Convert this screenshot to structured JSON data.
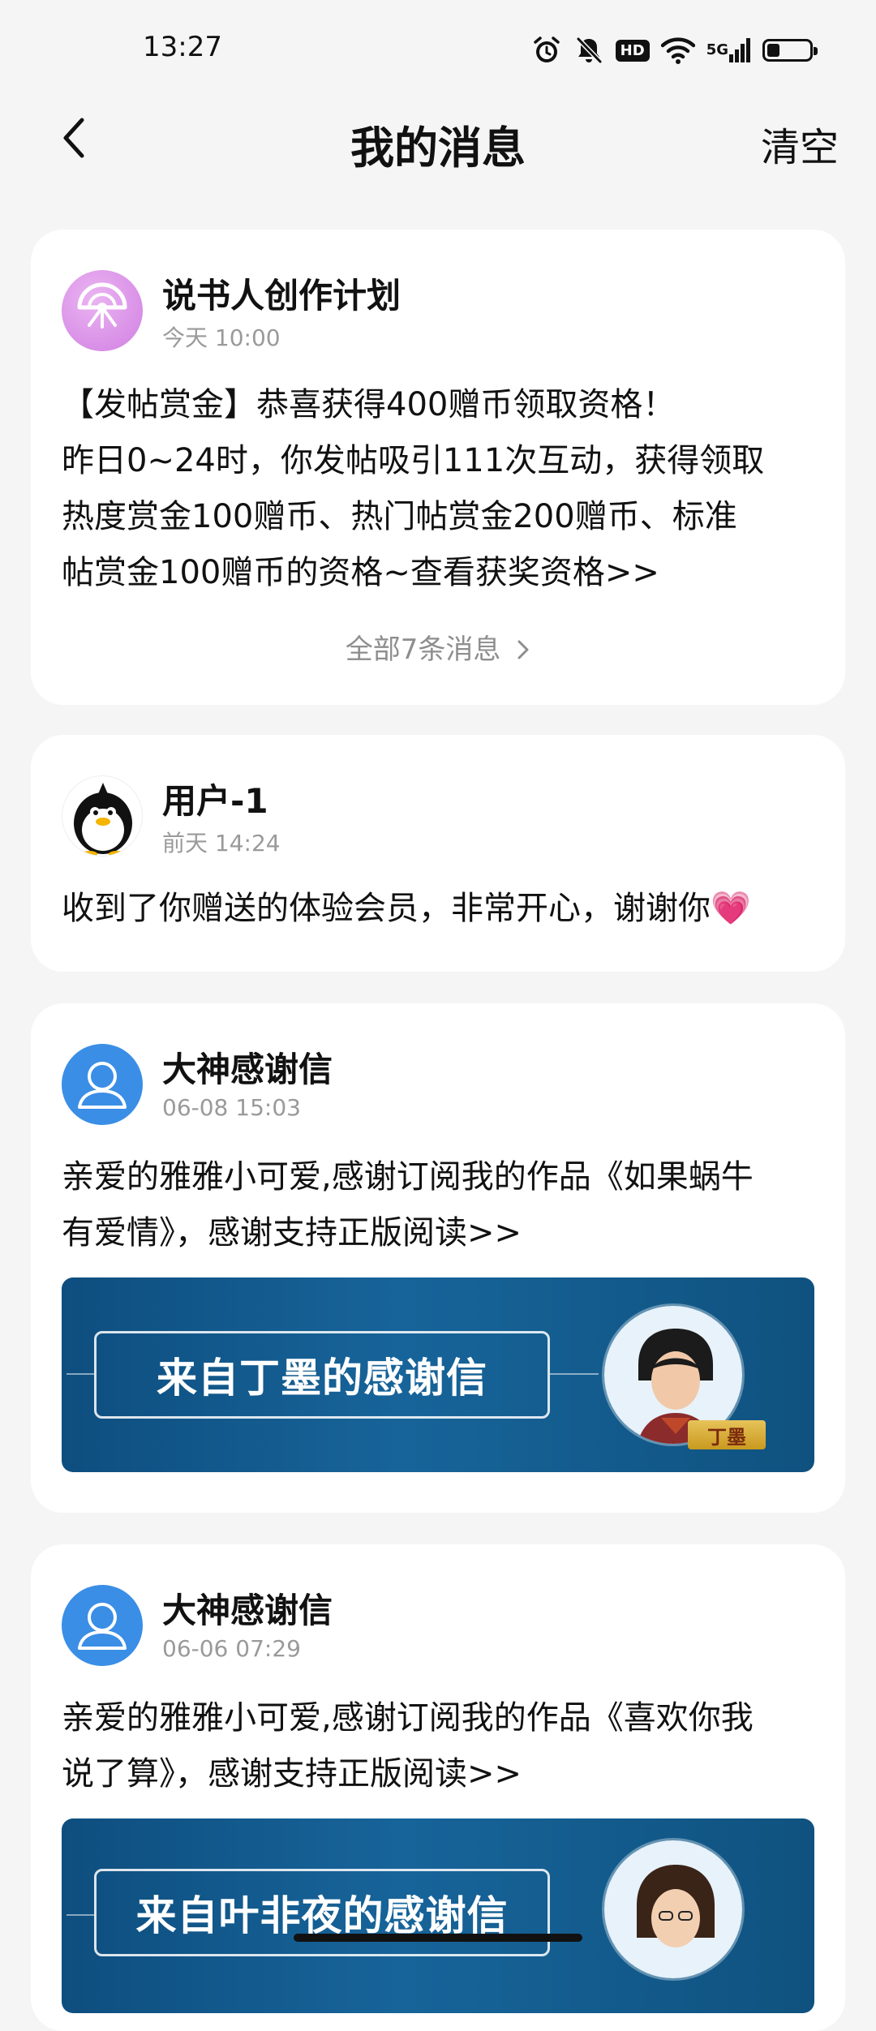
{
  "status_bar": {
    "time": "13:27",
    "hd_label": "HD",
    "network_label": "5G",
    "icons": [
      "alarm-icon",
      "mute-bell-icon",
      "hd-icon",
      "wifi-icon",
      "signal-5g-icon",
      "battery-icon"
    ],
    "battery_level": 0.3
  },
  "header": {
    "title": "我的消息",
    "clear_label": "清空",
    "back_icon": "chevron-left-icon"
  },
  "messages": [
    {
      "sender": "说书人创作计划",
      "time": "今天 10:00",
      "avatar_icon": "fan-icon",
      "lines": [
        "【发帖赏金】恭喜获得400赠币领取资格！",
        "昨日0~24时，你发帖吸引111次互动，获得领取",
        "热度赏金100赠币、热门帖赏金200赠币、标准",
        "帖赏金100赠币的资格~查看获奖资格>>"
      ],
      "more_label": "全部7条消息"
    },
    {
      "sender": "用户-1",
      "time": "前天 14:24",
      "avatar_icon": "penguin-avatar",
      "lines": [
        "收到了你赠送的体验会员，非常开心，谢谢你💗"
      ]
    },
    {
      "sender": "大神感谢信",
      "time": "06-08 15:03",
      "avatar_icon": "user-silhouette-icon",
      "lines": [
        "亲爱的雅雅小可爱,感谢订阅我的作品《如果蜗牛",
        "有爱情》，感谢支持正版阅读>>"
      ],
      "banner": {
        "title": "来自丁墨的感谢信",
        "author_tag": "丁墨"
      }
    },
    {
      "sender": "大神感谢信",
      "time": "06-06 07:29",
      "avatar_icon": "user-silhouette-icon",
      "lines": [
        "亲爱的雅雅小可爱,感谢订阅我的作品《喜欢你我",
        "说了算》，感谢支持正版阅读>>"
      ],
      "banner": {
        "title": "来自叶非夜的感谢信"
      }
    }
  ],
  "colors": {
    "background": "#f5f5f5",
    "card": "#ffffff",
    "banner_blue": "#17649a",
    "avatar_blue": "#3a8ee6",
    "fan_purple": "#d88be6",
    "secondary_text": "#9a9a9a"
  }
}
